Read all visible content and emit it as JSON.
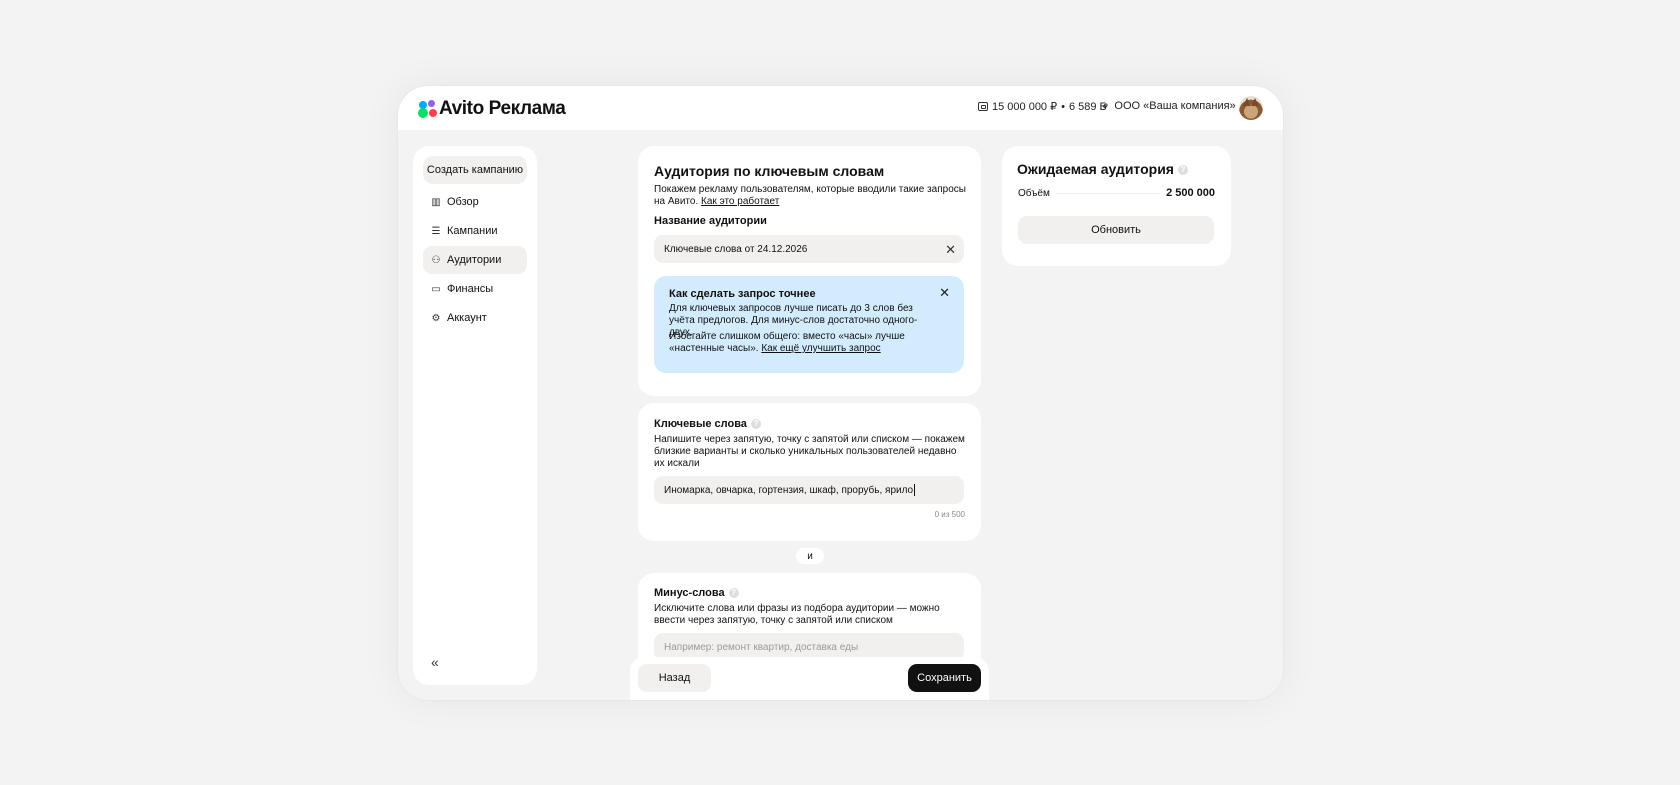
{
  "header": {
    "logo_text": "Avito Реклама",
    "balance_money": "15 000 000 ₽",
    "balance_separator": "•",
    "balance_bonus": "6 589 Б",
    "company": "ООО «Ваша компания»"
  },
  "sidebar": {
    "create_label": "Создать кампанию",
    "items": [
      {
        "label": "Обзор",
        "icon": "chart-icon"
      },
      {
        "label": "Кампании",
        "icon": "list-icon"
      },
      {
        "label": "Аудитории",
        "icon": "users-icon",
        "active": true
      },
      {
        "label": "Финансы",
        "icon": "wallet-icon"
      },
      {
        "label": "Аккаунт",
        "icon": "gear-icon"
      }
    ],
    "collapse_glyph": "«"
  },
  "audience": {
    "title": "Аудитория по ключевым словам",
    "desc": "Покажем рекламу пользователям, которые вводили такие запросы на Авито.",
    "desc_link": "Как это работает",
    "name_label": "Название аудитории",
    "name_value": "Ключевые слова от 24.12.2026",
    "hint": {
      "title": "Как сделать запрос точнее",
      "text1": "Для ключевых запросов лучше писать до 3 слов без учёта предлогов. Для минус-слов достаточно одного-двух.",
      "text2": "Избегайте слишком общего: вместо «часы» лучше «настенные часы».",
      "link": "Как ещё улучшить запрос"
    }
  },
  "keywords": {
    "title": "Ключевые слова",
    "desc": "Напишите через запятую, точку с запятой или списком — покажем близкие варианты и сколько уникальных пользователей недавно их искали",
    "value": "Иномарка, овчарка, гортензия, шкаф, прорубь, ярило",
    "counter": "0 из 500"
  },
  "and_label": "и",
  "minus": {
    "title": "Минус-слова",
    "desc": "Исключите слова или фразы из подбора аудитории — можно ввести через запятую, точку с запятой или списком",
    "placeholder": "Например: ремонт квартир, доставка еды"
  },
  "footer": {
    "back_label": "Назад",
    "save_label": "Сохранить"
  },
  "expected": {
    "title": "Ожидаемая аудитория",
    "volume_label": "Объём",
    "volume_value": "2 500 000",
    "refresh_label": "Обновить"
  }
}
